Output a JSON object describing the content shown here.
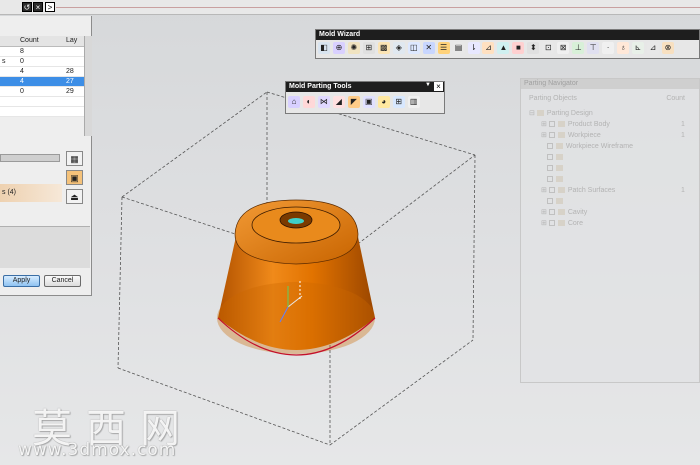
{
  "titlebar": {
    "close_glyph": "×",
    "expand_glyph": ">",
    "reset_glyph": "↺"
  },
  "left_dialog": {
    "columns": [
      "",
      "Count",
      "Lay"
    ],
    "rows": [
      {
        "name": "",
        "count": "8",
        "layer": ""
      },
      {
        "name": "s",
        "count": "0",
        "layer": ""
      },
      {
        "name": "",
        "count": "4",
        "layer": "28"
      },
      {
        "name": "",
        "count": "4",
        "layer": "27",
        "selected": true
      },
      {
        "name": "",
        "count": "0",
        "layer": "29"
      }
    ],
    "orange_row_label": "s (4)",
    "apply_label": "Apply",
    "cancel_label": "Cancel"
  },
  "mold_wizard": {
    "title": "Mold Wizard"
  },
  "parting_tools": {
    "title": "Mold Parting Tools"
  },
  "navigator": {
    "title": "Parting Navigator",
    "col_objects": "Parting Objects",
    "col_count": "Count",
    "items": [
      {
        "label": "Parting Design",
        "count": ""
      },
      {
        "label": "Product Body",
        "count": "1"
      },
      {
        "label": "Workpiece",
        "count": "1"
      },
      {
        "label": "Workpiece Wireframe",
        "count": ""
      },
      {
        "label": "Patch Surfaces",
        "count": "1"
      },
      {
        "label": "Cavity",
        "count": ""
      },
      {
        "label": "Core",
        "count": ""
      }
    ]
  },
  "watermark": {
    "chinese": "莫西网",
    "url": "www.3dmox.com"
  },
  "colors": {
    "part_orange": "#e27300",
    "selection_blue": "#3d8ee6",
    "titlebar_dark": "#1e1e1e"
  }
}
